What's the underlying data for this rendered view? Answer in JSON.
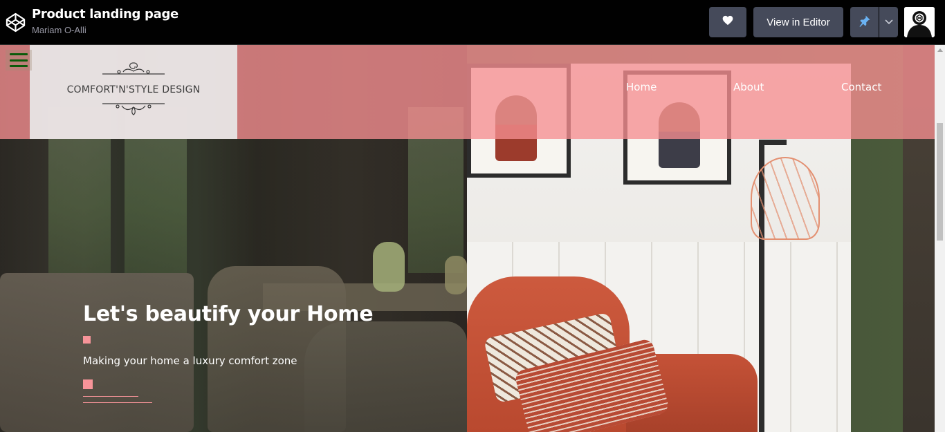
{
  "codepen": {
    "title": "Product landing page",
    "author": "Mariam O-Alli",
    "view_in_editor_label": "View in Editor",
    "icons": {
      "logo": "codepen-logo-icon",
      "like": "heart-icon",
      "pin": "pin-icon",
      "dropdown": "chevron-down-icon",
      "avatar": "user-avatar"
    },
    "colors": {
      "bar": "#010101",
      "button": "#454a5a",
      "pin": "#6ab2f2"
    }
  },
  "site": {
    "logo_text": "COMFORT'N'STYLE DESIGN",
    "nav": [
      {
        "label": "Home"
      },
      {
        "label": "About"
      },
      {
        "label": "Contact"
      }
    ],
    "hero": {
      "title": "Let's beautify your Home",
      "subtitle": "Making your home a luxury comfort zone"
    },
    "colors": {
      "header_pink": "#f68e91",
      "accent_pink": "#f79499",
      "menu_icon": "#0a5a0a"
    }
  }
}
